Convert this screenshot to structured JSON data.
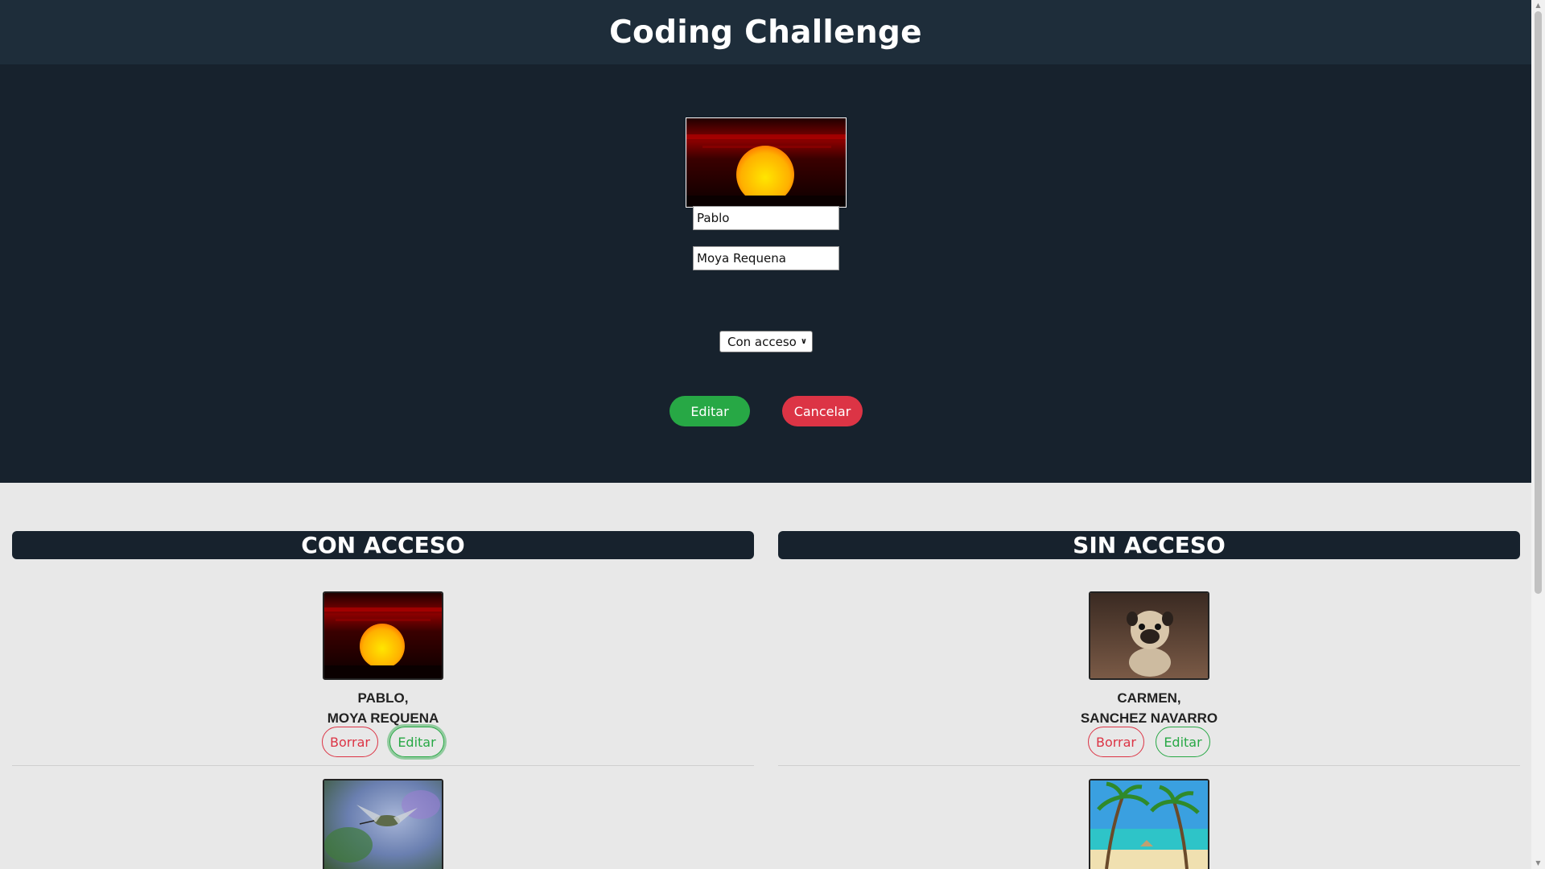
{
  "header": {
    "title": "Coding Challenge"
  },
  "form": {
    "photo_icon": "sunset-photo",
    "first_name_value": "Pablo",
    "last_name_value": "Moya Requena",
    "access_select_value": "Con acceso",
    "edit_label": "Editar",
    "cancel_label": "Cancelar"
  },
  "columns": {
    "with_access": {
      "title": "CON ACCESO",
      "cards": [
        {
          "first_name": "PABLO,",
          "last_name": "MOYA REQUENA",
          "photo": "sunset-photo",
          "delete_label": "Borrar",
          "edit_label": "Editar"
        },
        {
          "photo": "hummingbird-photo"
        }
      ]
    },
    "without_access": {
      "title": "SIN ACCESO",
      "cards": [
        {
          "first_name": "CARMEN,",
          "last_name": "SANCHEZ NAVARRO",
          "photo": "pug-photo",
          "delete_label": "Borrar",
          "edit_label": "Editar"
        },
        {
          "photo": "beach-photo"
        }
      ]
    }
  },
  "colors": {
    "header_bg": "#1e2d3a",
    "form_bg": "#17222d",
    "success": "#27a845",
    "danger": "#dc3445"
  }
}
